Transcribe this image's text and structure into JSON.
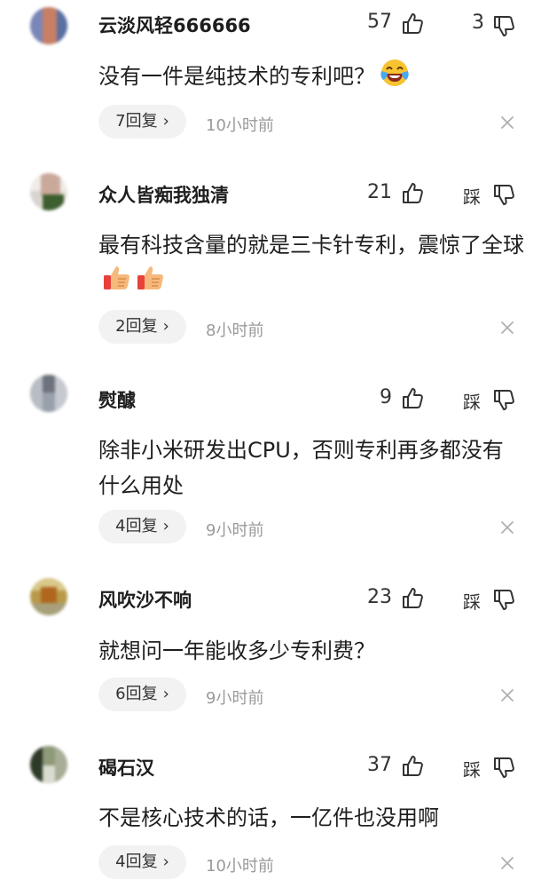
{
  "comments": [
    {
      "username": "云淡风轻666666",
      "likes": "57",
      "dislike": "3",
      "content": "没有一件是纯技术的专利吧？",
      "content_emoji": "crying-laughing-emoji",
      "reply_count": "7回复",
      "time": "10小时前"
    },
    {
      "username": "众人皆痴我独清",
      "likes": "21",
      "dislike": "踩",
      "content": "最有科技含量的就是三卡针专利，震惊了全球",
      "content_emoji": "thumbs-up-emoji",
      "reply_count": "2回复",
      "time": "8小时前"
    },
    {
      "username": "熨醵",
      "likes": "9",
      "dislike": "踩",
      "content": "除非小米研发出CPU，否则专利再多都没有什么用处",
      "reply_count": "4回复",
      "time": "9小时前"
    },
    {
      "username": "风吹沙不响",
      "likes": "23",
      "dislike": "踩",
      "content": "就想问一年能收多少专利费？",
      "reply_count": "6回复",
      "time": "9小时前"
    },
    {
      "username": "碣石汉",
      "likes": "37",
      "dislike": "踩",
      "content": "不是核心技术的话，一亿件也没用啊",
      "reply_count": "4回复",
      "time": "10小时前"
    }
  ],
  "icons": {
    "like": "thumb-up-outline-icon",
    "dislike": "thumb-down-outline-icon",
    "chevron": "chevron-right-icon",
    "close": "close-icon"
  },
  "colors": {
    "text": "#1f1f1f",
    "muted": "#9a9a9a",
    "pill": "#f2f2f2",
    "icon": "#333333"
  }
}
